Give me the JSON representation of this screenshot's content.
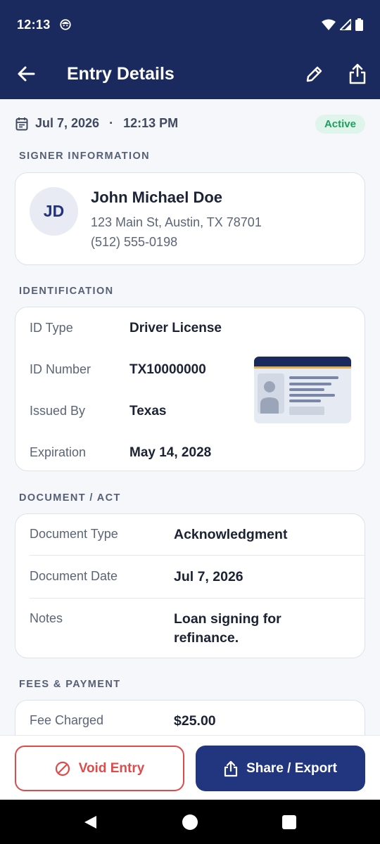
{
  "status_bar": {
    "time": "12:13"
  },
  "app_bar": {
    "title": "Entry Details"
  },
  "entry": {
    "date": "Jul 7, 2026",
    "separator": "·",
    "time": "12:13 PM",
    "status": "Active"
  },
  "signer": {
    "section_label": "SIGNER INFORMATION",
    "initials": "JD",
    "name": "John Michael Doe",
    "address": "123 Main St, Austin, TX 78701",
    "phone": "(512) 555-0198"
  },
  "identification": {
    "section_label": "IDENTIFICATION",
    "rows": [
      {
        "label": "ID Type",
        "value": "Driver License"
      },
      {
        "label": "ID Number",
        "value": "TX10000000"
      },
      {
        "label": "Issued By",
        "value": "Texas"
      },
      {
        "label": "Expiration",
        "value": "May 14, 2028"
      }
    ]
  },
  "document": {
    "section_label": "DOCUMENT / ACT",
    "rows": [
      {
        "label": "Document Type",
        "value": "Acknowledgment"
      },
      {
        "label": "Document Date",
        "value": "Jul 7, 2026"
      },
      {
        "label": "Notes",
        "value": "Loan signing for refinance."
      }
    ]
  },
  "fees": {
    "section_label": "FEES & PAYMENT",
    "rows": [
      {
        "label": "Fee Charged",
        "value": "$25.00"
      }
    ]
  },
  "actions": {
    "void_label": "Void Entry",
    "share_label": "Share / Export"
  },
  "colors": {
    "primary": "#1a2a5e",
    "danger": "#de4b4b",
    "active_badge_bg": "#dff4ea",
    "active_badge_text": "#1e9e5f"
  },
  "icons": [
    "back-arrow-icon",
    "pencil-icon",
    "share-icon",
    "calendar-icon",
    "id-card-icon",
    "void-icon",
    "back-triangle-icon",
    "home-circle-icon",
    "recents-square-icon"
  ]
}
